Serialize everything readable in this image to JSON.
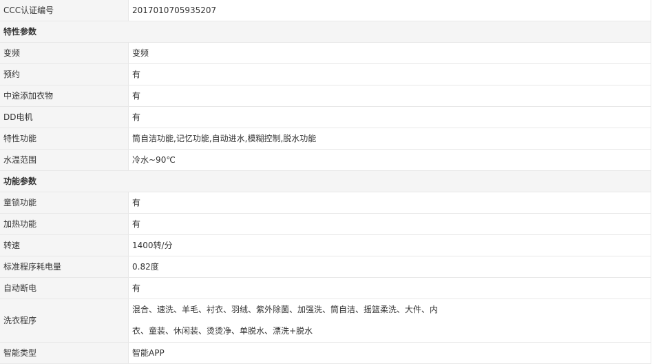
{
  "ccc_row": {
    "label": "CCC认证编号",
    "value": "2017010705935207"
  },
  "section_features": {
    "title": "特性参数"
  },
  "features": [
    {
      "label": "变频",
      "value": "变频"
    },
    {
      "label": "预约",
      "value": "有"
    },
    {
      "label": "中途添加衣物",
      "value": "有"
    },
    {
      "label": "DD电机",
      "value": "有"
    },
    {
      "label": "特性功能",
      "value": "筒自洁功能,记忆功能,自动进水,模糊控制,脱水功能"
    },
    {
      "label": "水温范围",
      "value": "冷水~90℃"
    }
  ],
  "section_functions": {
    "title": "功能参数"
  },
  "functions": [
    {
      "label": "童锁功能",
      "value": "有"
    },
    {
      "label": "加热功能",
      "value": "有"
    },
    {
      "label": "转速",
      "value": "1400转/分"
    },
    {
      "label": "标准程序耗电量",
      "value": "0.82度"
    },
    {
      "label": "自动断电",
      "value": "有"
    },
    {
      "label": "洗衣程序",
      "value_line1": "混合、速洗、羊毛、衬衣、羽绒、紫外除菌、加强洗、筒自洁、摇篮柔洗、大件、内",
      "value_line2": "衣、童装、休闲装、烫烫净、单脱水、漂洗+脱水"
    },
    {
      "label": "智能类型",
      "value": "智能APP"
    }
  ]
}
